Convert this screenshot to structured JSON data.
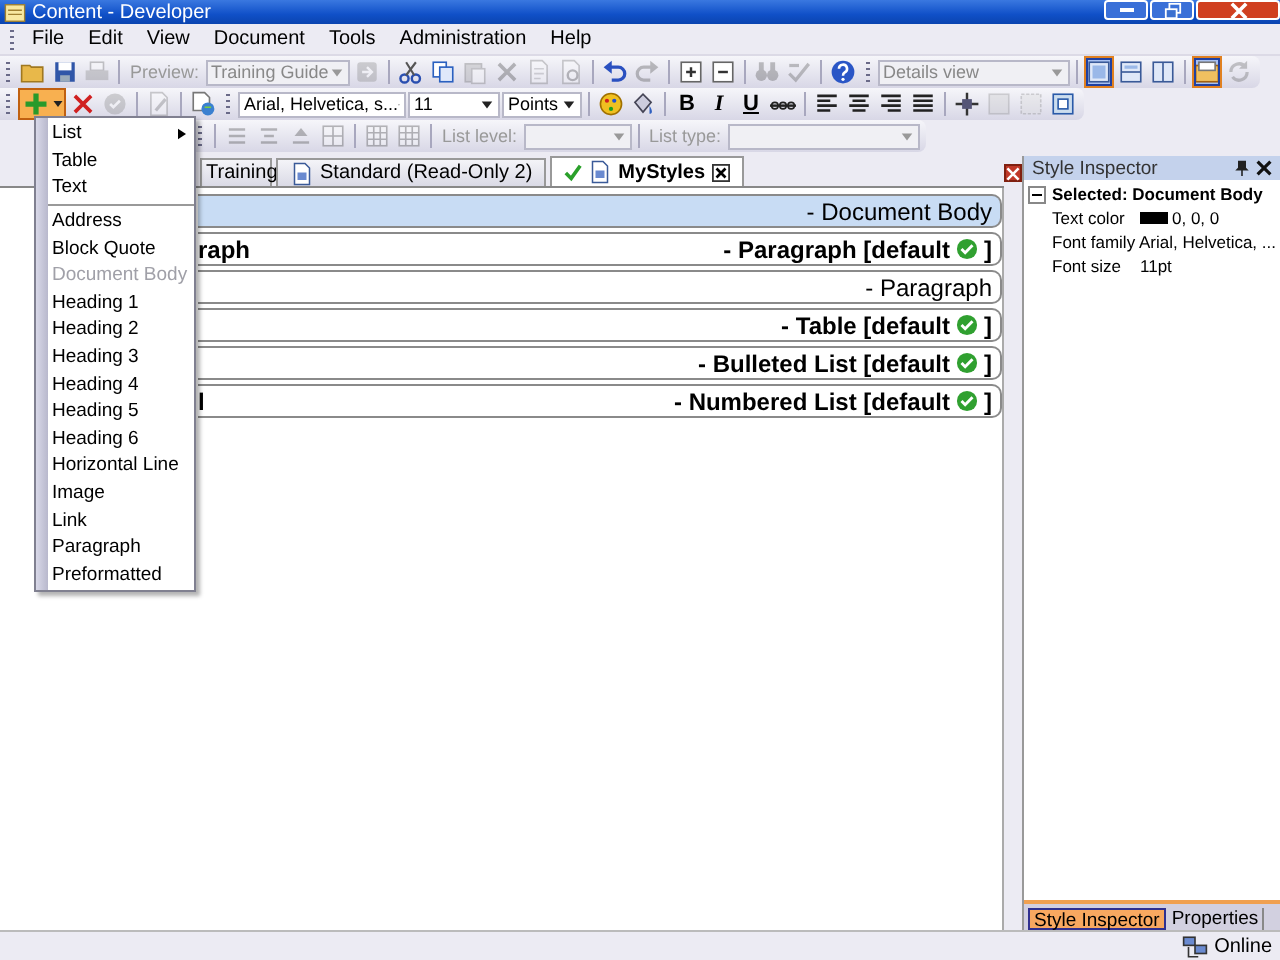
{
  "window": {
    "title": "Content - Developer"
  },
  "menu_bar": [
    "File",
    "Edit",
    "View",
    "Document",
    "Tools",
    "Administration",
    "Help"
  ],
  "toolbar_1": {
    "items": [
      {
        "kind": "button",
        "disabled": false
      },
      {
        "kind": "button",
        "disabled": false
      },
      {
        "kind": "button",
        "disabled": true
      },
      {
        "kind": "separator"
      },
      {
        "kind": "label",
        "text": "Preview:",
        "disabled": true
      },
      {
        "kind": "combo",
        "value": "Training Guide",
        "disabled": true
      },
      {
        "kind": "button",
        "disabled": true
      },
      {
        "kind": "separator"
      },
      {
        "kind": "button",
        "disabled": false
      },
      {
        "kind": "button",
        "disabled": false
      },
      {
        "kind": "button",
        "disabled": true
      },
      {
        "kind": "button",
        "disabled": true
      },
      {
        "kind": "button",
        "disabled": true
      },
      {
        "kind": "button",
        "disabled": true
      },
      {
        "kind": "separator"
      },
      {
        "kind": "button",
        "disabled": false
      },
      {
        "kind": "button",
        "disabled": true
      },
      {
        "kind": "separator"
      },
      {
        "kind": "button",
        "disabled": false
      },
      {
        "kind": "button",
        "disabled": false
      },
      {
        "kind": "separator"
      },
      {
        "kind": "button",
        "disabled": true
      },
      {
        "kind": "button",
        "disabled": true
      },
      {
        "kind": "separator"
      },
      {
        "kind": "button",
        "disabled": false
      },
      {
        "kind": "grip"
      },
      {
        "kind": "combo",
        "value": "Details view",
        "disabled": true
      },
      {
        "kind": "separator"
      },
      {
        "kind": "button",
        "disabled": false,
        "selected": true
      },
      {
        "kind": "button",
        "disabled": false,
        "selected": false
      },
      {
        "kind": "button",
        "disabled": false,
        "selected": false
      },
      {
        "kind": "separator"
      },
      {
        "kind": "button",
        "disabled": false,
        "selected": true
      },
      {
        "kind": "button",
        "disabled": true
      }
    ]
  },
  "toolbar_2": {
    "items": [
      {
        "kind": "menu-button",
        "disabled": false,
        "pressed": true
      },
      {
        "kind": "button",
        "disabled": false
      },
      {
        "kind": "button",
        "disabled": true
      },
      {
        "kind": "separator"
      },
      {
        "kind": "button",
        "disabled": true
      },
      {
        "kind": "separator"
      },
      {
        "kind": "button",
        "disabled": false
      },
      {
        "kind": "grip"
      },
      {
        "kind": "combo",
        "value": "Arial, Helvetica, s...",
        "disabled": false
      },
      {
        "kind": "combo",
        "value": "11",
        "disabled": false
      },
      {
        "kind": "combo",
        "value": "Points",
        "disabled": false
      },
      {
        "kind": "separator"
      },
      {
        "kind": "button",
        "disabled": false
      },
      {
        "kind": "button",
        "disabled": false
      },
      {
        "kind": "separator"
      },
      {
        "kind": "text-button",
        "text": "B",
        "disabled": false
      },
      {
        "kind": "text-button",
        "text": "I",
        "disabled": false
      },
      {
        "kind": "text-button",
        "text": "U",
        "disabled": false
      },
      {
        "kind": "button",
        "disabled": false
      },
      {
        "kind": "separator"
      },
      {
        "kind": "button",
        "disabled": false
      },
      {
        "kind": "button",
        "disabled": false
      },
      {
        "kind": "button",
        "disabled": false
      },
      {
        "kind": "button",
        "disabled": false
      },
      {
        "kind": "separator"
      },
      {
        "kind": "button",
        "disabled": false
      },
      {
        "kind": "button",
        "disabled": true
      },
      {
        "kind": "button",
        "disabled": true
      },
      {
        "kind": "button",
        "disabled": false
      }
    ]
  },
  "toolbar_3": {
    "items": [
      {
        "kind": "separator"
      },
      {
        "kind": "button",
        "disabled": true
      },
      {
        "kind": "button",
        "disabled": true
      },
      {
        "kind": "button",
        "disabled": true
      },
      {
        "kind": "button",
        "disabled": true
      },
      {
        "kind": "separator"
      },
      {
        "kind": "button",
        "disabled": true
      },
      {
        "kind": "button",
        "disabled": true
      },
      {
        "kind": "separator"
      },
      {
        "kind": "label",
        "text": "List level:",
        "disabled": true
      },
      {
        "kind": "combo",
        "value": "",
        "disabled": true
      },
      {
        "kind": "separator"
      },
      {
        "kind": "label",
        "text": "List type:",
        "disabled": true
      },
      {
        "kind": "combo",
        "value": "",
        "disabled": true
      }
    ]
  },
  "tabs": [
    {
      "label": "Training",
      "selected": false
    },
    {
      "label": "Standard (Read-Only 2)",
      "selected": false
    },
    {
      "label": "MyStyles",
      "selected": true,
      "valid": true
    }
  ],
  "styles": [
    {
      "label": "- Document Body",
      "bold": false,
      "selected": true
    },
    {
      "left_text": "raph",
      "label": "- Paragraph [default",
      "closing": "]",
      "bold": true,
      "is_default": true,
      "selected": false
    },
    {
      "label": "- Paragraph",
      "bold": false,
      "selected": false
    },
    {
      "label": "- Table [default",
      "closing": "]",
      "bold": true,
      "is_default": true,
      "selected": false
    },
    {
      "label": "- Bulleted List [default",
      "closing": "]",
      "bold": true,
      "is_default": true,
      "selected": false
    },
    {
      "left_text": "l",
      "label": "- Numbered List [default",
      "closing": "]",
      "bold": true,
      "is_default": true,
      "selected": false
    }
  ],
  "insert_menu": [
    {
      "label": "List",
      "kind": "submenu",
      "disabled": false
    },
    {
      "label": "Table",
      "kind": "item",
      "disabled": false
    },
    {
      "label": "Text",
      "kind": "item",
      "disabled": false
    },
    {
      "kind": "separator"
    },
    {
      "label": "Address",
      "kind": "item",
      "disabled": false
    },
    {
      "label": "Block Quote",
      "kind": "item",
      "disabled": false
    },
    {
      "label": "Document Body",
      "kind": "item",
      "disabled": true
    },
    {
      "label": "Heading 1",
      "kind": "item",
      "disabled": false
    },
    {
      "label": "Heading 2",
      "kind": "item",
      "disabled": false
    },
    {
      "label": "Heading 3",
      "kind": "item",
      "disabled": false
    },
    {
      "label": "Heading 4",
      "kind": "item",
      "disabled": false
    },
    {
      "label": "Heading 5",
      "kind": "item",
      "disabled": false
    },
    {
      "label": "Heading 6",
      "kind": "item",
      "disabled": false
    },
    {
      "label": "Horizontal Line",
      "kind": "item",
      "disabled": false
    },
    {
      "label": "Image",
      "kind": "item",
      "disabled": false
    },
    {
      "label": "Link",
      "kind": "item",
      "disabled": false
    },
    {
      "label": "Paragraph",
      "kind": "item",
      "disabled": false
    },
    {
      "label": "Preformatted",
      "kind": "item",
      "disabled": false
    }
  ],
  "style_inspector": {
    "title": "Style Inspector",
    "node": {
      "label": "Selected: Document Body",
      "expanded": true
    },
    "properties": [
      {
        "name": "Text color",
        "value": "0, 0, 0",
        "color": "#000000"
      },
      {
        "name": "Font family",
        "value": "Arial, Helvetica, ..."
      },
      {
        "name": "Font size",
        "value": "11pt"
      }
    ],
    "tabs": [
      {
        "label": "Style Inspector",
        "selected": true
      },
      {
        "label": "Properties",
        "selected": false
      }
    ]
  },
  "status_bar": {
    "connection": "Online"
  }
}
